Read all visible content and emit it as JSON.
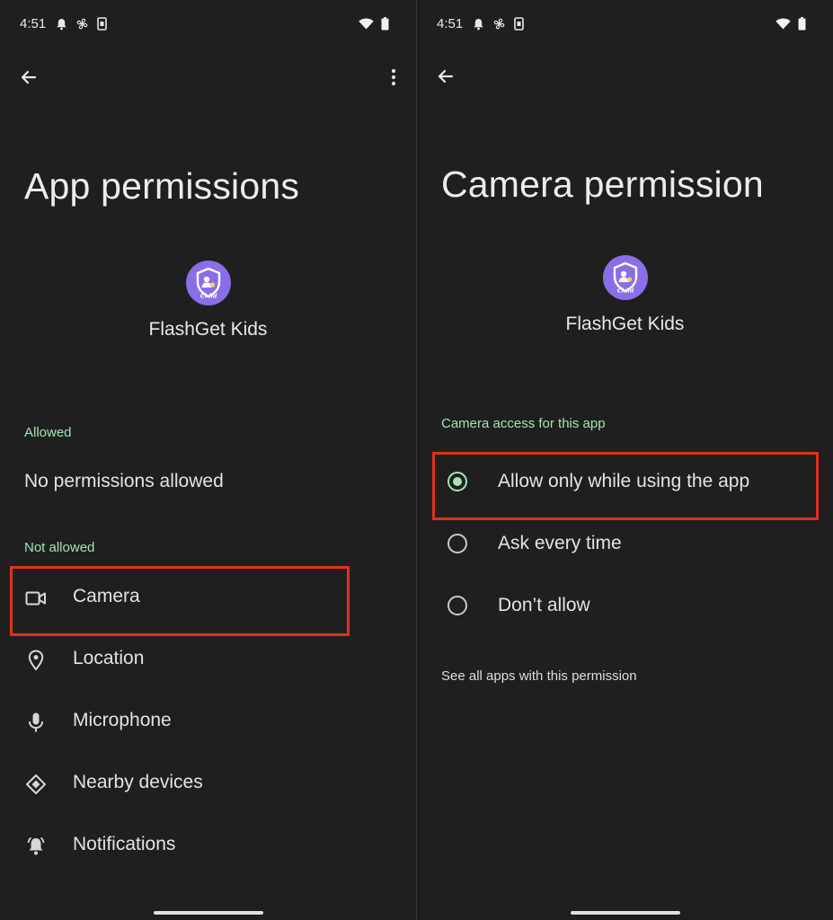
{
  "status_bar": {
    "time": "4:51",
    "left_icons": [
      "bell-icon",
      "fan-icon",
      "sim-icon"
    ],
    "right_icons": [
      "wifi-icon",
      "battery-icon"
    ]
  },
  "left_screen": {
    "title": "App permissions",
    "app_name": "FlashGet Kids",
    "app_icon_badge": "Child",
    "allowed_label": "Allowed",
    "allowed_empty_text": "No permissions allowed",
    "not_allowed_label": "Not allowed",
    "not_allowed_items": [
      {
        "label": "Camera",
        "icon": "camera-icon"
      },
      {
        "label": "Location",
        "icon": "location-icon"
      },
      {
        "label": "Microphone",
        "icon": "microphone-icon"
      },
      {
        "label": "Nearby devices",
        "icon": "nearby-devices-icon"
      },
      {
        "label": "Notifications",
        "icon": "notification-bell-icon"
      }
    ]
  },
  "right_screen": {
    "title": "Camera permission",
    "app_name": "FlashGet Kids",
    "app_icon_badge": "Child",
    "section_label": "Camera access for this app",
    "options": [
      {
        "label": "Allow only while using the app",
        "selected": true
      },
      {
        "label": "Ask every time",
        "selected": false
      },
      {
        "label": "Don’t allow",
        "selected": false
      }
    ],
    "footer_link": "See all apps with this permission"
  },
  "colors": {
    "background": "#1f1f1f",
    "accent_green": "#a6e3b0",
    "highlight_red": "#e0301e",
    "app_icon_purple": "#8a6ee8"
  }
}
